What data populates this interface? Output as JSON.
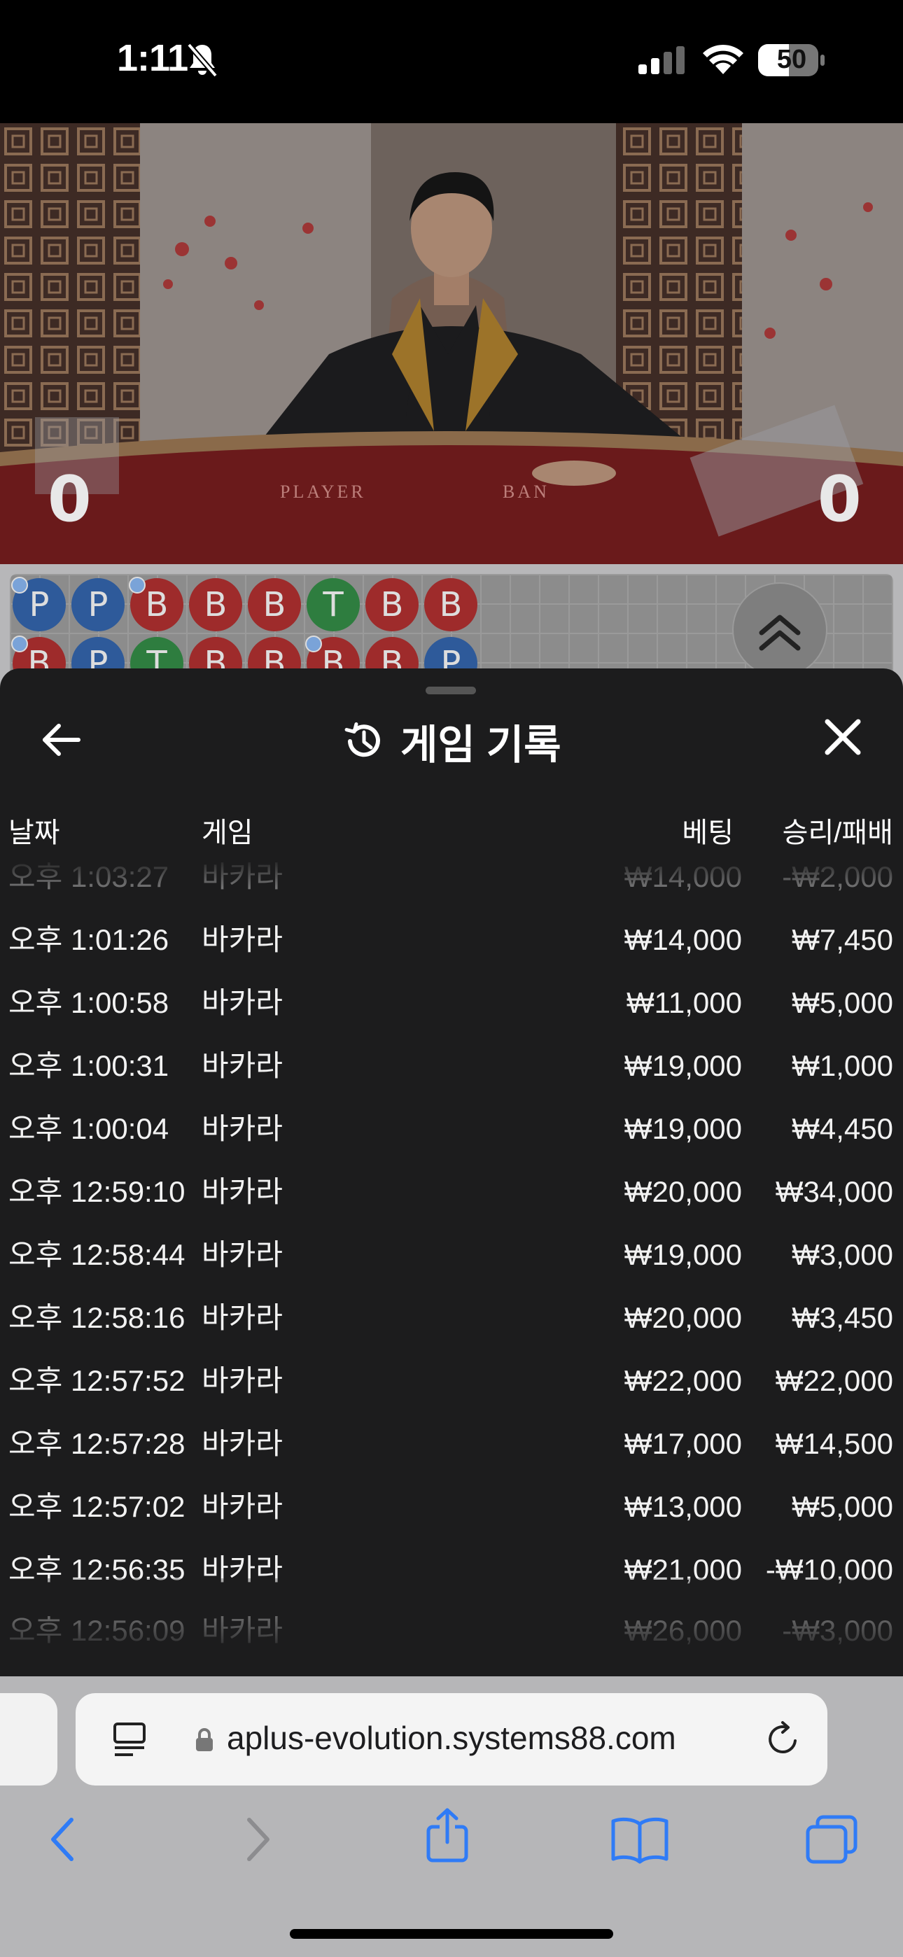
{
  "status_bar": {
    "time": "1:11",
    "battery": "50"
  },
  "video": {
    "player_score": "0",
    "banker_score": "0",
    "table_left_label": "PLAYER",
    "table_right_label": "BAN"
  },
  "roadmap": {
    "row1": [
      "P",
      "P",
      "B",
      "B",
      "B",
      "T",
      "B",
      "B"
    ],
    "row2": [
      "B",
      "P",
      "T",
      "B",
      "B",
      "B",
      "B",
      "P"
    ]
  },
  "history": {
    "title": "게임 기록",
    "columns": {
      "date": "날짜",
      "game": "게임",
      "bet": "베팅",
      "result": "승리/패배"
    },
    "rows": [
      {
        "time": "오후 1:03:27",
        "game": "바카라",
        "bet": "₩14,000",
        "result": "-₩2,000"
      },
      {
        "time": "오후 1:01:26",
        "game": "바카라",
        "bet": "₩14,000",
        "result": "₩7,450"
      },
      {
        "time": "오후 1:00:58",
        "game": "바카라",
        "bet": "₩11,000",
        "result": "₩5,000"
      },
      {
        "time": "오후 1:00:31",
        "game": "바카라",
        "bet": "₩19,000",
        "result": "₩1,000"
      },
      {
        "time": "오후 1:00:04",
        "game": "바카라",
        "bet": "₩19,000",
        "result": "₩4,450"
      },
      {
        "time": "오후 12:59:10",
        "game": "바카라",
        "bet": "₩20,000",
        "result": "₩34,000"
      },
      {
        "time": "오후 12:58:44",
        "game": "바카라",
        "bet": "₩19,000",
        "result": "₩3,000"
      },
      {
        "time": "오후 12:58:16",
        "game": "바카라",
        "bet": "₩20,000",
        "result": "₩3,450"
      },
      {
        "time": "오후 12:57:52",
        "game": "바카라",
        "bet": "₩22,000",
        "result": "₩22,000"
      },
      {
        "time": "오후 12:57:28",
        "game": "바카라",
        "bet": "₩17,000",
        "result": "₩14,500"
      },
      {
        "time": "오후 12:57:02",
        "game": "바카라",
        "bet": "₩13,000",
        "result": "₩5,000"
      },
      {
        "time": "오후 12:56:35",
        "game": "바카라",
        "bet": "₩21,000",
        "result": "-₩10,000"
      },
      {
        "time": "오후 12:56:09",
        "game": "바카라",
        "bet": "₩26,000",
        "result": "-₩3,000"
      }
    ]
  },
  "browser": {
    "url": "aplus-evolution.systems88.com"
  },
  "icons": {
    "back": "arrow-left-icon",
    "close": "close-icon",
    "history": "history-clock-icon",
    "reader": "reader-icon",
    "lock": "lock-icon",
    "reload": "reload-icon",
    "nav": [
      "chevron-left-icon",
      "chevron-right-icon",
      "share-icon",
      "bookmarks-icon",
      "tabs-icon"
    ]
  },
  "colors": {
    "sheet_bg": "#1c1c1d",
    "player_blue": "#2e5a9a",
    "banker_red": "#9e2b2b",
    "tie_green": "#2e7d3f",
    "ios_blue": "#2f7bf6"
  }
}
